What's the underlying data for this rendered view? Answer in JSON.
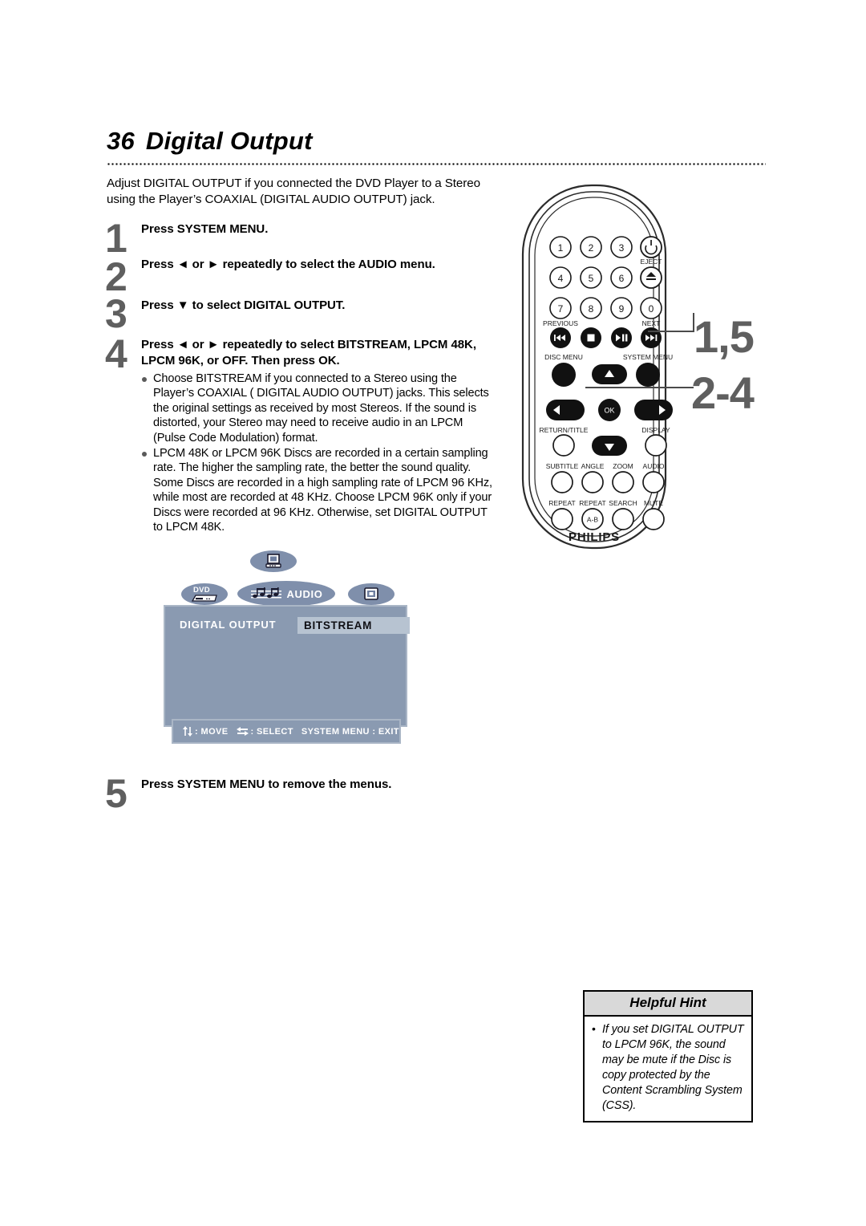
{
  "page": {
    "number": "36",
    "title": "Digital Output",
    "intro": "Adjust DIGITAL OUTPUT if you connected the DVD Player to a Stereo using the Player’s COAXIAL (DIGITAL AUDIO OUTPUT) jack."
  },
  "steps": [
    {
      "number": "1",
      "heading": "Press SYSTEM MENU."
    },
    {
      "number": "2",
      "heading": "Press ◄ or ► repeatedly to select the AUDIO menu."
    },
    {
      "number": "3",
      "heading": "Press ▼ to select DIGITAL OUTPUT."
    },
    {
      "number": "4",
      "heading": "Press ◄ or ► repeatedly to select BITSTREAM, LPCM 48K, LPCM 96K, or OFF. Then press OK.",
      "bullets": [
        "Choose BITSTREAM if you connected to a Stereo using the Player’s COAXIAL ( DIGITAL AUDIO OUTPUT) jacks. This selects the original settings as received by most Stereos. If the sound is distorted, your Stereo may need to receive audio in an LPCM (Pulse Code Modulation) format.",
        "LPCM 48K or LPCM 96K Discs are recorded in a certain sampling rate. The higher the sampling rate, the better the sound quality. Some Discs are recorded in a high sampling rate of LPCM 96 KHz, while most are recorded at 48 KHz. Choose LPCM 96K only if your Discs were recorded at 96 KHz. Otherwise, set DIGITAL OUTPUT to LPCM 48K."
      ]
    },
    {
      "number": "5",
      "heading": "Press SYSTEM MENU to remove the menus."
    }
  ],
  "osd": {
    "tabs": [
      {
        "name": "display-top",
        "label": "",
        "icon": "monitor-icon",
        "selected": false
      },
      {
        "name": "dvd",
        "label": "DVD",
        "icon": "dvd-player-icon",
        "selected": false
      },
      {
        "name": "audio",
        "label": "AUDIO",
        "icon": "music-note-icon",
        "selected": true
      },
      {
        "name": "picture",
        "label": "",
        "icon": "picture-icon",
        "selected": false
      }
    ],
    "setting_label": "DIGITAL OUTPUT",
    "setting_value": "BITSTREAM",
    "statusbar": [
      {
        "icon": "up-down-arrows-icon",
        "text": ": MOVE"
      },
      {
        "icon": "left-right-arrows-icon",
        "text": ": SELECT"
      },
      {
        "icon": "",
        "text": "SYSTEM MENU : EXIT"
      }
    ],
    "colors": {
      "panel": "#8a9ab1",
      "panel_border": "#aab6c6",
      "tab": "#7f8fab",
      "value_box": "#b7c3d1"
    }
  },
  "remote": {
    "brand": "PHILIPS",
    "numeric_keys": [
      "1",
      "2",
      "3",
      "4",
      "5",
      "6",
      "7",
      "8",
      "9",
      "0"
    ],
    "power_label": "",
    "eject_label": "EJECT",
    "transport": [
      {
        "label": "PREVIOUS",
        "icon": "previous-icon"
      },
      {
        "label": "",
        "icon": "stop-icon"
      },
      {
        "label": "",
        "icon": "play-pause-icon"
      },
      {
        "label": "NEXT",
        "icon": "next-icon"
      }
    ],
    "disc_menu_label": "DISC MENU",
    "system_menu_label": "SYSTEM MENU",
    "ok_label": "OK",
    "return_title_label": "RETURN/TITLE",
    "display_label": "DISPLAY",
    "function_row1": [
      "SUBTITLE",
      "ANGLE",
      "ZOOM",
      "AUDIO"
    ],
    "function_row2": [
      "REPEAT",
      "REPEAT",
      "SEARCH",
      "MUTE"
    ],
    "repeat_ab_label": "A-B"
  },
  "callouts": [
    {
      "name": "callout-system-menu",
      "text": "1,5"
    },
    {
      "name": "callout-navigation",
      "text": "2-4"
    }
  ],
  "helpful_hint": {
    "title": "Helpful Hint",
    "items": [
      "If you set DIGITAL OUTPUT to LPCM 96K, the sound may be mute if the Disc is copy protected by the Content Scrambling System (CSS)."
    ]
  }
}
